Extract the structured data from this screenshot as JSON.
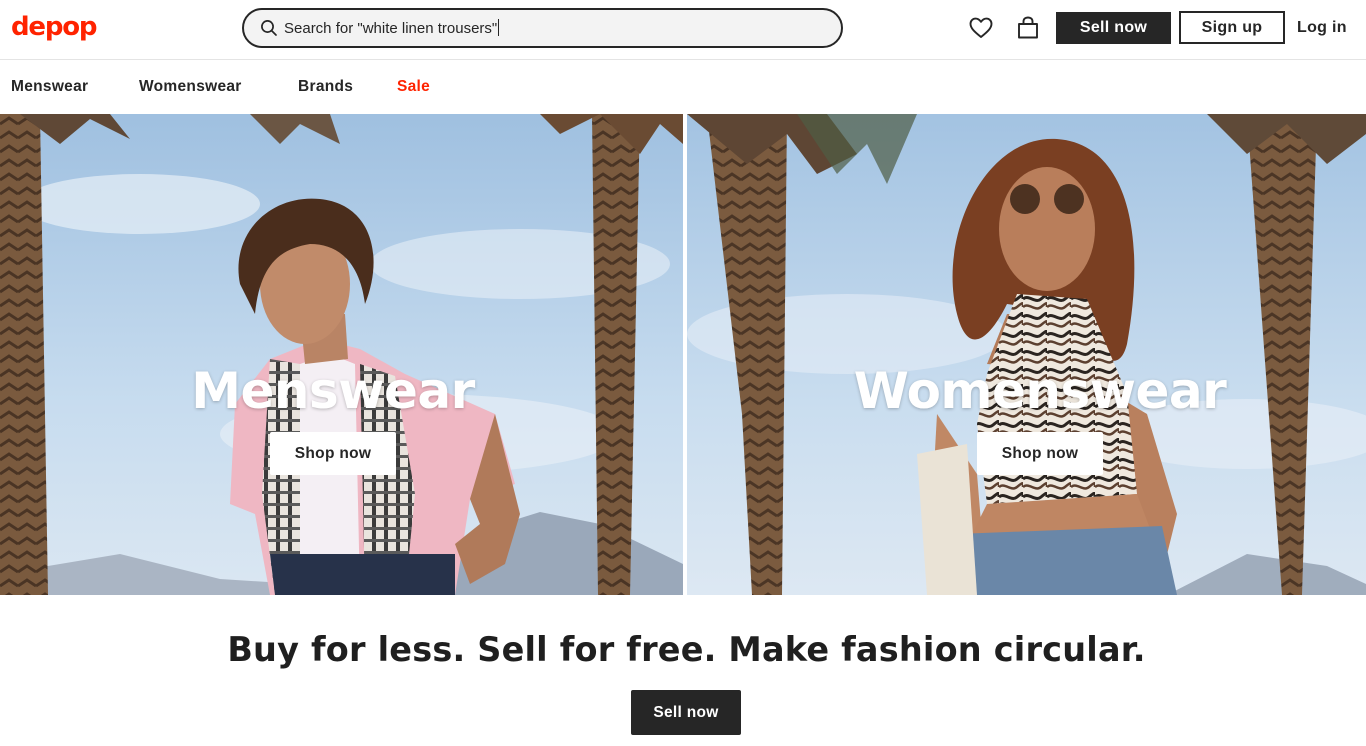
{
  "header": {
    "logo": "depop",
    "search": {
      "value": "Search for \"white linen trousers\""
    },
    "icons": {
      "favorites": "heart-icon",
      "bag": "shopping-bag-icon",
      "search": "search-icon"
    },
    "sell_now_label": "Sell now",
    "sign_up_label": "Sign up",
    "log_in_label": "Log in"
  },
  "nav": {
    "items": [
      {
        "label": "Menswear"
      },
      {
        "label": "Womenswear"
      },
      {
        "label": "Brands"
      },
      {
        "label": "Sale",
        "accent": "#ff2300"
      }
    ]
  },
  "hero": {
    "left": {
      "title": "Menswear",
      "cta": "Shop now"
    },
    "right": {
      "title": "Womenswear",
      "cta": "Shop now"
    }
  },
  "tagline": "Buy for less. Sell for free. Make fashion circular.",
  "bottom_cta": "Sell now",
  "colors": {
    "brand": "#ff2300",
    "dark": "#262626",
    "sky": "#b9d3ea"
  }
}
